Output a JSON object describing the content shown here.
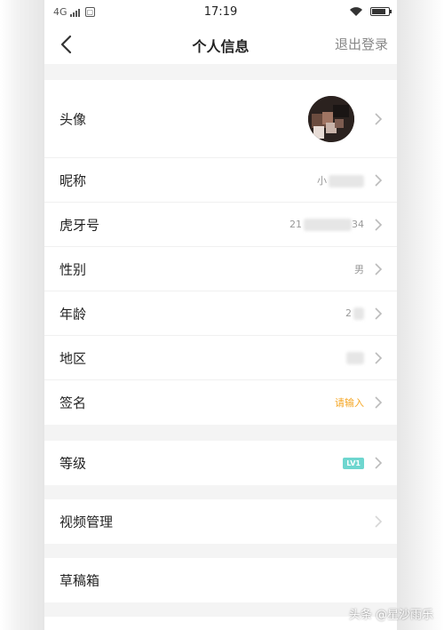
{
  "status_bar": {
    "network": "4G",
    "sim": "",
    "time": "17:19"
  },
  "nav": {
    "title": "个人信息",
    "logout_label": "退出登录"
  },
  "profile": {
    "rows": [
      {
        "label": "头像"
      },
      {
        "label": "昵称",
        "value": "小"
      },
      {
        "label": "虎牙号",
        "value_prefix": "21",
        "value_suffix": "34"
      },
      {
        "label": "性别",
        "value": "男"
      },
      {
        "label": "年龄",
        "value": "2"
      },
      {
        "label": "地区",
        "value": ""
      },
      {
        "label": "签名",
        "placeholder": "请输入"
      }
    ]
  },
  "level": {
    "label": "等级",
    "badge": "LV1",
    "badge_color": "#6ed6cf"
  },
  "video": {
    "label": "视频管理"
  },
  "drafts": {
    "label": "草稿箱"
  },
  "watermark": "头条 @星沙雨乐",
  "colors": {
    "accent_orange": "#f5a623",
    "background": "#f4f4f4"
  }
}
